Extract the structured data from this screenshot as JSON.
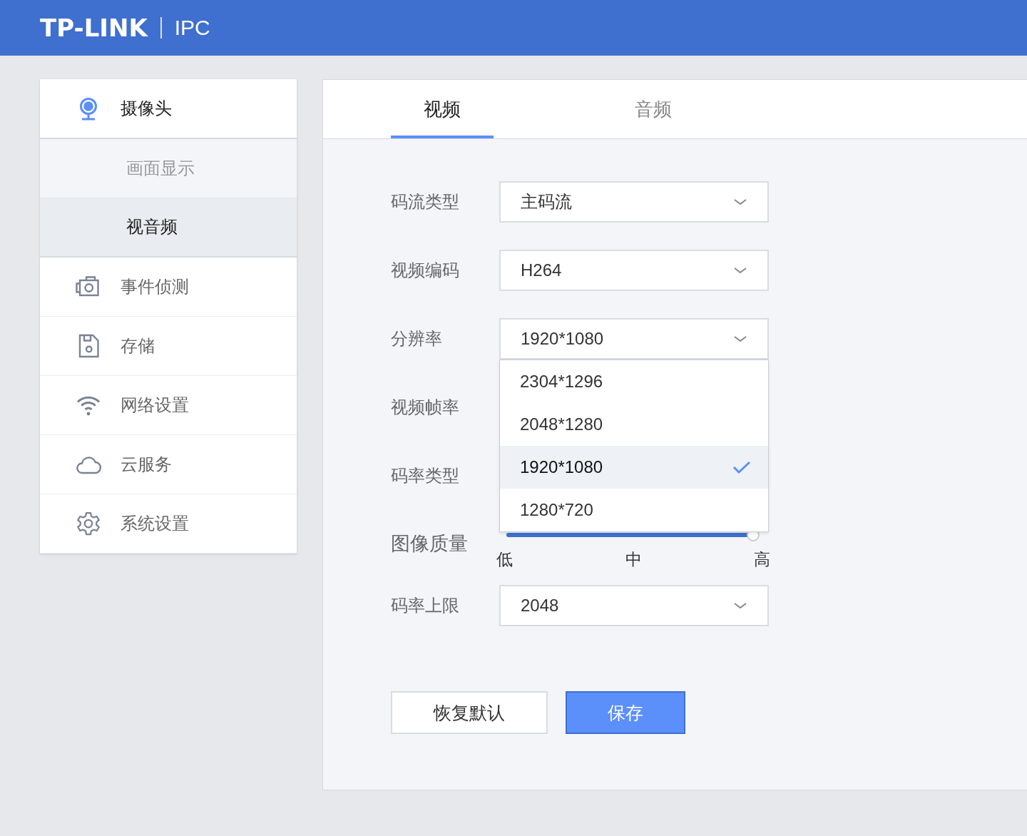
{
  "header": {
    "logo": "TP-LINK",
    "product": "IPC"
  },
  "sidebar": {
    "items": [
      {
        "label": "摄像头",
        "selected": true,
        "expanded": true,
        "children": [
          {
            "label": "画面显示",
            "selected": false
          },
          {
            "label": "视音频",
            "selected": true
          }
        ]
      },
      {
        "label": "事件侦测",
        "selected": false
      },
      {
        "label": "存储",
        "selected": false
      },
      {
        "label": "网络设置",
        "selected": false
      },
      {
        "label": "云服务",
        "selected": false
      },
      {
        "label": "系统设置",
        "selected": false
      }
    ]
  },
  "tabs": [
    {
      "label": "视频",
      "selected": true
    },
    {
      "label": "音频",
      "selected": false
    }
  ],
  "form": {
    "fields": [
      {
        "kind": "select",
        "label": "码流类型",
        "value": "主码流"
      },
      {
        "kind": "select",
        "label": "视频编码",
        "value": "H264"
      },
      {
        "kind": "select",
        "label": "分辨率",
        "value": "1920*1080",
        "open": true,
        "options": [
          {
            "label": "2304*1296",
            "selected": false
          },
          {
            "label": "2048*1280",
            "selected": false
          },
          {
            "label": "1920*1080",
            "selected": true
          },
          {
            "label": "1280*720",
            "selected": false
          }
        ]
      },
      {
        "kind": "covered",
        "label": "视频帧率"
      },
      {
        "kind": "covered",
        "label": "码率类型"
      },
      {
        "kind": "slider",
        "label": "图像质量",
        "level": 1,
        "ticks": [
          "低",
          "中",
          "高"
        ]
      },
      {
        "kind": "select",
        "label": "码率上限",
        "value": "2048"
      }
    ]
  },
  "buttons": [
    {
      "label": "恢复默认",
      "kind": "secondary"
    },
    {
      "label": "保存",
      "kind": "primary"
    }
  ]
}
